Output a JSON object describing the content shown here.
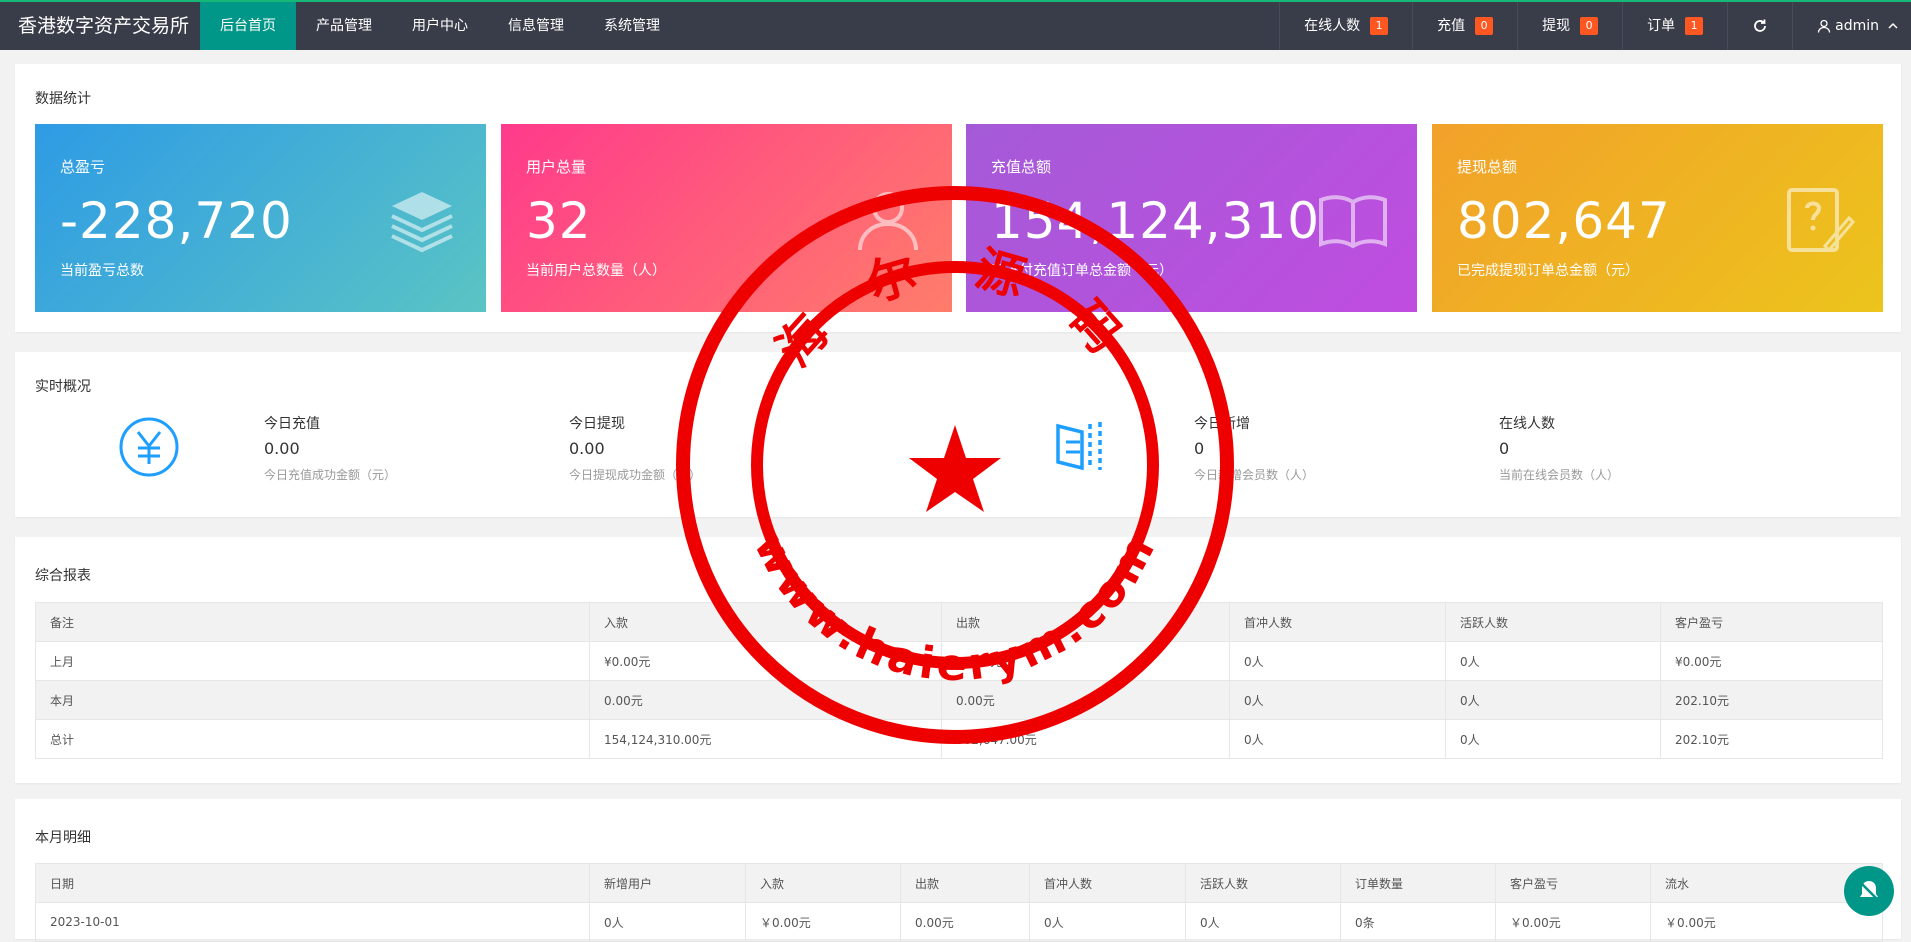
{
  "brand": "香港数字资产交易所",
  "nav": {
    "items": [
      "后台首页",
      "产品管理",
      "用户中心",
      "信息管理",
      "系统管理"
    ],
    "right": [
      {
        "label": "在线人数",
        "badge": "1"
      },
      {
        "label": "充值",
        "badge": "0"
      },
      {
        "label": "提现",
        "badge": "0"
      },
      {
        "label": "订单",
        "badge": "1"
      }
    ],
    "user": "admin"
  },
  "stats": {
    "title": "数据统计",
    "cards": [
      {
        "label": "总盈亏",
        "value": "-228,720",
        "sub": "当前盈亏总数",
        "icon": "layers-icon"
      },
      {
        "label": "用户总量",
        "value": "32",
        "sub": "当前用户总数量（人）",
        "icon": "user-icon"
      },
      {
        "label": "充值总额",
        "value": "154,124,310",
        "sub": "已支付充值订单总金额（元）",
        "icon": "book-icon"
      },
      {
        "label": "提现总额",
        "value": "802,647",
        "sub": "已完成提现订单总金额（元）",
        "icon": "edit-icon"
      }
    ]
  },
  "realtime": {
    "title": "实时概况",
    "items": [
      {
        "label": "今日充值",
        "value": "0.00",
        "sub": "今日充值成功金额（元）"
      },
      {
        "label": "今日提现",
        "value": "0.00",
        "sub": "今日提现成功金额（元）"
      },
      {
        "label": "今日新增",
        "value": "0",
        "sub": "今日新增会员数（人）"
      },
      {
        "label": "在线人数",
        "value": "0",
        "sub": "当前在线会员数（人）"
      }
    ]
  },
  "report": {
    "title": "综合报表",
    "headers": [
      "备注",
      "入款",
      "出款",
      "首冲人数",
      "活跃人数",
      "客户盈亏"
    ],
    "rows": [
      [
        "上月",
        "¥0.00元",
        "¥0.00元",
        "0人",
        "0人",
        "¥0.00元"
      ],
      [
        "本月",
        "0.00元",
        "0.00元",
        "0人",
        "0人",
        "202.10元"
      ],
      [
        "总计",
        "154,124,310.00元",
        "802,647.00元",
        "0人",
        "0人",
        "202.10元"
      ]
    ]
  },
  "monthly": {
    "title": "本月明细",
    "headers": [
      "日期",
      "新增用户",
      "入款",
      "出款",
      "首冲人数",
      "活跃人数",
      "订单数量",
      "客户盈亏",
      "流水"
    ],
    "rows": [
      [
        "2023-10-01",
        "0人",
        "￥0.00元",
        "0.00元",
        "0人",
        "0人",
        "0条",
        "￥0.00元",
        "￥0.00元"
      ]
    ]
  },
  "stamp": {
    "text_top": "海 尔 源 码",
    "text_bottom": "www.haierym.com",
    "color": "#ee0000"
  },
  "colors": {
    "nav_bg": "#393d49",
    "nav_active": "#009688",
    "badge": "#ff5722",
    "icon_blue": "#1e9fff"
  }
}
